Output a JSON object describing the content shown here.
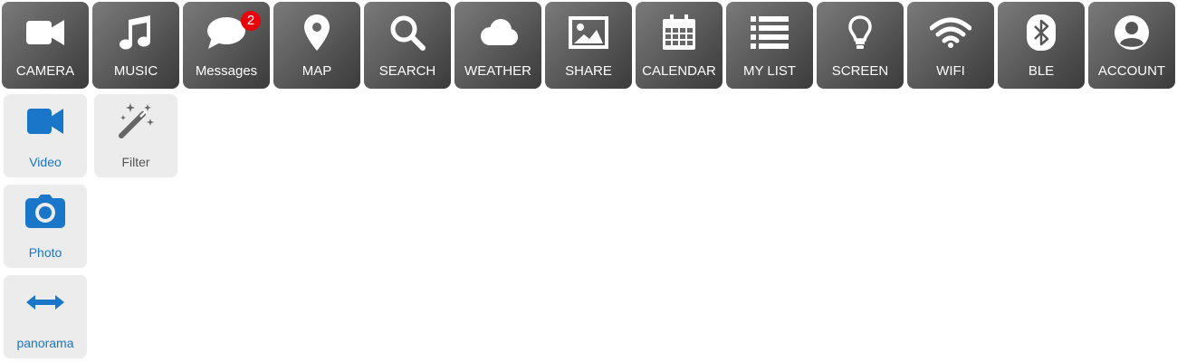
{
  "toolbar": {
    "items": [
      {
        "label": "CAMERA",
        "icon": "video-camera-icon"
      },
      {
        "label": "MUSIC",
        "icon": "music-note-icon"
      },
      {
        "label": "Messages",
        "icon": "chat-bubble-icon",
        "badge": "2"
      },
      {
        "label": "MAP",
        "icon": "map-pin-icon"
      },
      {
        "label": "SEARCH",
        "icon": "search-icon"
      },
      {
        "label": "WEATHER",
        "icon": "cloud-icon"
      },
      {
        "label": "SHARE",
        "icon": "image-icon"
      },
      {
        "label": "CALENDAR",
        "icon": "calendar-icon"
      },
      {
        "label": "MY LIST",
        "icon": "list-icon"
      },
      {
        "label": "SCREEN",
        "icon": "lightbulb-icon"
      },
      {
        "label": "WIFI",
        "icon": "wifi-icon"
      },
      {
        "label": "BLE",
        "icon": "bluetooth-icon"
      },
      {
        "label": "ACCOUNT",
        "icon": "user-icon"
      }
    ]
  },
  "camera_submenu": {
    "video": {
      "label": "Video",
      "icon": "video-camera-icon"
    },
    "filter": {
      "label": "Filter",
      "icon": "magic-wand-icon"
    },
    "photo": {
      "label": "Photo",
      "icon": "photo-camera-icon"
    },
    "panorama": {
      "label": "panorama",
      "icon": "horizontal-arrows-icon"
    }
  },
  "colors": {
    "tile_gradient_start": "#7a7a7a",
    "tile_gradient_end": "#3c3c3c",
    "badge": "#e8000b",
    "accent_blue": "#1976c8",
    "submenu_background": "#ececec",
    "filter_icon": "#666666"
  }
}
